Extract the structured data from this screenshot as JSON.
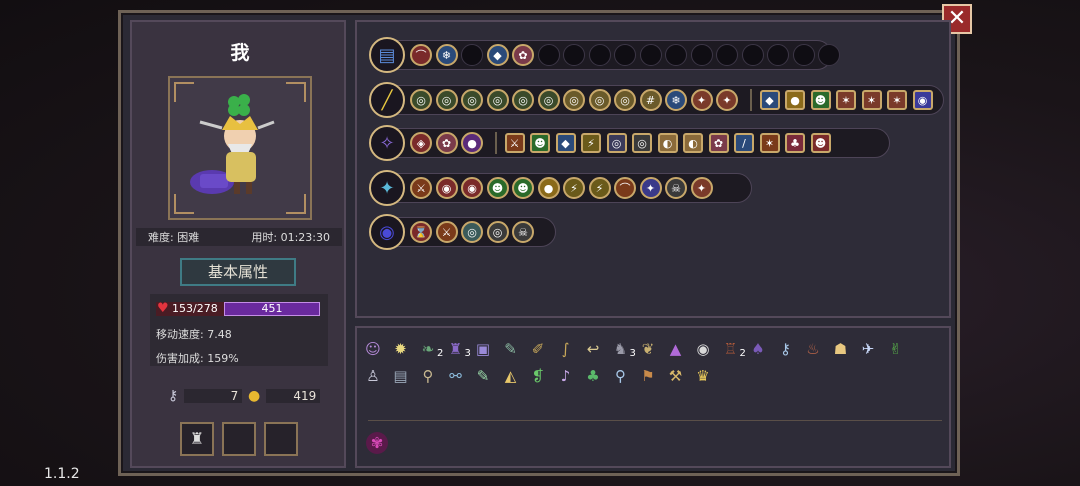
{
  "player": {
    "name": "我",
    "difficulty_label": "难度: 困难",
    "time_label": "用时: 01:23:30"
  },
  "attributes": {
    "title": "基本属性",
    "hp": "153/278",
    "mp": "451",
    "move_speed": "移动速度: 7.48",
    "damage_bonus": "伤害加成: 159%"
  },
  "resources": {
    "keys": "7",
    "coins": "419"
  },
  "version": "1.1.2",
  "colors": {
    "frame": "#6e6256",
    "panel": "#2e2c38",
    "gold": "#c8a86a",
    "hp": "#e3343e",
    "mp": "#6a2a9e",
    "close": "#9a2a2a"
  },
  "rows": [
    {
      "id": "bag",
      "icon": "chest-icon",
      "chips": [
        {
          "c": "#7a2a2a",
          "g": "⌒"
        },
        {
          "c": "#2a4a7a",
          "g": "❄"
        },
        {
          "c": "empty",
          "g": ""
        },
        {
          "c": "#2a4a7a",
          "g": "◆"
        },
        {
          "c": "#7a3a4a",
          "g": "✿"
        },
        {
          "c": "empty",
          "g": ""
        },
        {
          "c": "empty",
          "g": ""
        },
        {
          "c": "empty",
          "g": ""
        },
        {
          "c": "empty",
          "g": ""
        },
        {
          "c": "empty",
          "g": ""
        },
        {
          "c": "empty",
          "g": ""
        },
        {
          "c": "empty",
          "g": ""
        },
        {
          "c": "empty",
          "g": ""
        },
        {
          "c": "empty",
          "g": ""
        },
        {
          "c": "empty",
          "g": ""
        },
        {
          "c": "empty",
          "g": ""
        },
        {
          "c": "empty",
          "g": ""
        }
      ]
    },
    {
      "id": "sword",
      "icon": "sword-icon",
      "chips": [
        {
          "c": "#3a4a2a",
          "g": "◎"
        },
        {
          "c": "#3a4a2a",
          "g": "◎"
        },
        {
          "c": "#3a4a2a",
          "g": "◎"
        },
        {
          "c": "#3a4a2a",
          "g": "◎"
        },
        {
          "c": "#3a4a2a",
          "g": "◎"
        },
        {
          "c": "#3a4a2a",
          "g": "◎"
        },
        {
          "c": "#6a5a2a",
          "g": "◎"
        },
        {
          "c": "#6a5a2a",
          "g": "◎"
        },
        {
          "c": "#6a5a2a",
          "g": "◎"
        },
        {
          "c": "#6a5a2a",
          "g": "#"
        },
        {
          "c": "#2a4a7a",
          "g": "❄"
        },
        {
          "c": "#7a3a2a",
          "g": "✦"
        },
        {
          "c": "#7a3a2a",
          "g": "✦"
        }
      ],
      "squares": [
        {
          "c": "#2a4a7a",
          "g": "◆"
        },
        {
          "c": "#8a6a1a",
          "g": "●"
        },
        {
          "c": "#2a6a2a",
          "g": "☻"
        },
        {
          "c": "#7a3a2a",
          "g": "✶"
        },
        {
          "c": "#7a3a2a",
          "g": "✶"
        },
        {
          "c": "#7a3a2a",
          "g": "✶"
        },
        {
          "c": "#3a3a9a",
          "g": "◉"
        }
      ]
    },
    {
      "id": "staff",
      "icon": "staff-icon",
      "chips": [
        {
          "c": "#7a2a2a",
          "g": "◈"
        },
        {
          "c": "#7a3a4a",
          "g": "✿"
        },
        {
          "c": "#5a2a7a",
          "g": "●"
        }
      ],
      "squares": [
        {
          "c": "#7a3a1a",
          "g": "⚔"
        },
        {
          "c": "#2a6a2a",
          "g": "☻"
        },
        {
          "c": "#2a4a7a",
          "g": "◆"
        },
        {
          "c": "#6a5a1a",
          "g": "⚡"
        },
        {
          "c": "#3a3a5a",
          "g": "◎"
        },
        {
          "c": "#3a3a3a",
          "g": "◎"
        },
        {
          "c": "#8a6a3a",
          "g": "◐"
        },
        {
          "c": "#8a6a3a",
          "g": "◐"
        },
        {
          "c": "#7a3a4a",
          "g": "✿"
        },
        {
          "c": "#2a4a7a",
          "g": "/"
        },
        {
          "c": "#7a3a1a",
          "g": "✶"
        },
        {
          "c": "#7a2a3a",
          "g": "♣"
        },
        {
          "c": "#7a2a2a",
          "g": "☻"
        }
      ]
    },
    {
      "id": "shuriken",
      "icon": "shuriken-icon",
      "chips": [
        {
          "c": "#7a3a1a",
          "g": "⚔"
        },
        {
          "c": "#7a2a2a",
          "g": "◉"
        },
        {
          "c": "#7a2a2a",
          "g": "◉"
        },
        {
          "c": "#2a6a2a",
          "g": "☻"
        },
        {
          "c": "#2a6a2a",
          "g": "☻"
        },
        {
          "c": "#8a6a1a",
          "g": "●"
        },
        {
          "c": "#6a5a1a",
          "g": "⚡"
        },
        {
          "c": "#6a5a1a",
          "g": "⚡"
        },
        {
          "c": "#7a3a1a",
          "g": "⌒"
        },
        {
          "c": "#3a3a8a",
          "g": "✦"
        },
        {
          "c": "#3a3a3a",
          "g": "☠"
        },
        {
          "c": "#7a3a2a",
          "g": "✦"
        }
      ]
    },
    {
      "id": "vortex",
      "icon": "vortex-icon",
      "chips": [
        {
          "c": "#7a2a2a",
          "g": "⌛"
        },
        {
          "c": "#7a3a1a",
          "g": "⚔"
        },
        {
          "c": "#3a5a5a",
          "g": "◎"
        },
        {
          "c": "#3a3a3a",
          "g": "◎"
        },
        {
          "c": "#3a3a3a",
          "g": "☠"
        }
      ]
    }
  ],
  "items": {
    "row1": [
      {
        "g": "☺",
        "c": "#b58ad8"
      },
      {
        "g": "✹",
        "c": "#e8d880"
      },
      {
        "g": "❧",
        "c": "#6aa87a",
        "n": "2"
      },
      {
        "g": "♜",
        "c": "#8a6ac8",
        "n": "3"
      },
      {
        "g": "▣",
        "c": "#9a8ad8"
      },
      {
        "g": "✎",
        "c": "#8ab8a0"
      },
      {
        "g": "✐",
        "c": "#c8a85a"
      },
      {
        "g": "∫",
        "c": "#c8a85a"
      },
      {
        "g": "↩",
        "c": "#d8c890"
      },
      {
        "g": "♞",
        "c": "#9a9aa8",
        "n": "3"
      },
      {
        "g": "❦",
        "c": "#c8b070"
      },
      {
        "g": "▲",
        "c": "#b06ad8"
      },
      {
        "g": "◉",
        "c": "#d8d8d8"
      },
      {
        "g": "♖",
        "c": "#b05a3a",
        "n": "2"
      },
      {
        "g": "♠",
        "c": "#7a5ab8"
      },
      {
        "g": "⚷",
        "c": "#a8c8e8"
      },
      {
        "g": "♨",
        "c": "#c86a4a"
      },
      {
        "g": "☗",
        "c": "#e8c880"
      },
      {
        "g": "✈",
        "c": "#c8d8f8"
      },
      {
        "g": "✌",
        "c": "#5ab84a"
      }
    ],
    "row2": [
      {
        "g": "♙",
        "c": "#c8c8d8"
      },
      {
        "g": "▤",
        "c": "#9aa8b8"
      },
      {
        "g": "⚲",
        "c": "#c8b890"
      },
      {
        "g": "⚯",
        "c": "#8ab8d8"
      },
      {
        "g": "✎",
        "c": "#9ad8a8"
      },
      {
        "g": "◭",
        "c": "#e8c86a"
      },
      {
        "g": "❡",
        "c": "#6ac86a"
      },
      {
        "g": "♪",
        "c": "#c8a8e8"
      },
      {
        "g": "♣",
        "c": "#5ab86a"
      },
      {
        "g": "⚲",
        "c": "#a8c8e8"
      },
      {
        "g": "⚑",
        "c": "#c88a4a"
      },
      {
        "g": "⚒",
        "c": "#d8b86a"
      },
      {
        "g": "♛",
        "c": "#e8c85a"
      }
    ],
    "special": {
      "g": "✾",
      "c": "#d84ab8"
    }
  }
}
